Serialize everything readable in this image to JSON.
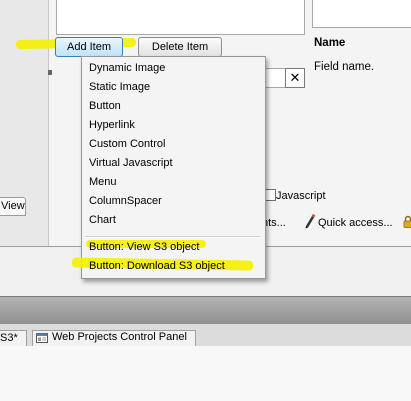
{
  "toolbar": {
    "add_item": "Add Item",
    "delete_item": "Delete Item"
  },
  "properties": {
    "name_header": "Name",
    "field_name": "Field name.",
    "clear_icon": "✕"
  },
  "options": {
    "javascript_label": "Javascript",
    "ellipsis_text": "nts...",
    "quick_access": "Quick access..."
  },
  "side_tab": {
    "label": "View"
  },
  "context_menu": {
    "items": [
      "Dynamic Image",
      "Static Image",
      "Button",
      "Hyperlink",
      "Custom Control",
      "Virtual Javascript",
      "Menu",
      "ColumnSpacer",
      "Chart"
    ],
    "extra_items": [
      "Button: View S3 object",
      "Button: Download S3 object"
    ]
  },
  "bottom_tabs": {
    "first": "S3*",
    "second": "Web Projects Control Panel"
  },
  "colors": {
    "highlight": "#f4ef00",
    "menu_background": "#f4f4f4",
    "selected_button": "#bfe3f7"
  }
}
